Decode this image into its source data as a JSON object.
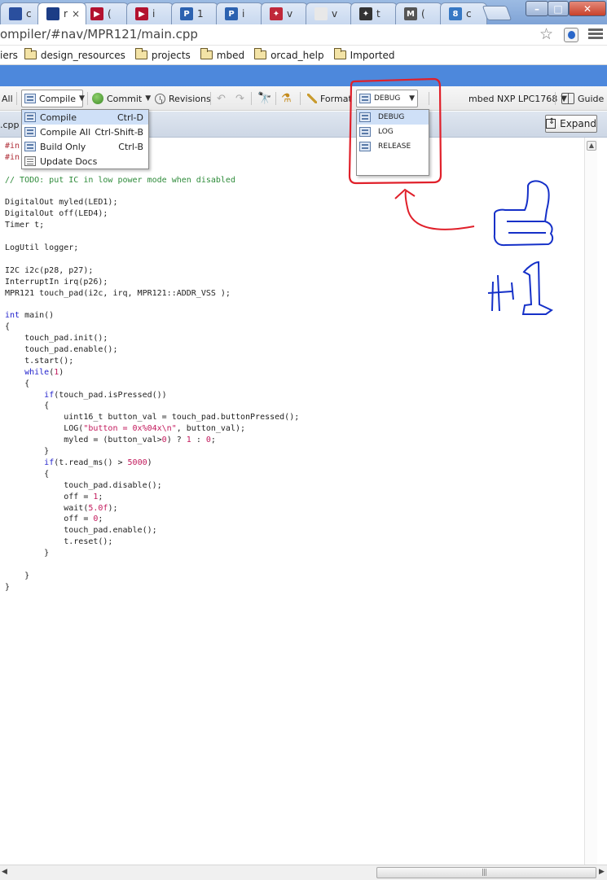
{
  "browser": {
    "tabs": [
      {
        "title": "c",
        "fav_color": "#2a4f9e",
        "fav_text": ""
      },
      {
        "title": "r",
        "fav_color": "#1c3d86",
        "fav_text": ""
      },
      {
        "title": "(",
        "fav_color": "#b3122f",
        "fav_text": "▶"
      },
      {
        "title": "i",
        "fav_color": "#b3122f",
        "fav_text": "▶"
      },
      {
        "title": "1",
        "fav_color": "#2c62b0",
        "fav_text": "P"
      },
      {
        "title": "i",
        "fav_color": "#2c62b0",
        "fav_text": "P"
      },
      {
        "title": "v",
        "fav_color": "#c0283a",
        "fav_text": "✦"
      },
      {
        "title": "v",
        "fav_color": "#e8e8e8",
        "fav_text": ""
      },
      {
        "title": "t",
        "fav_color": "#333333",
        "fav_text": "✦"
      },
      {
        "title": "(",
        "fav_color": "#555555",
        "fav_text": "M"
      },
      {
        "title": "c",
        "fav_color": "#3778c4",
        "fav_text": "8"
      }
    ],
    "active_tab_close": "×",
    "url": "ompiler/#nav/MPR121/main.cpp",
    "bookmarks": [
      {
        "label": "iers",
        "folder": false
      },
      {
        "label": "design_resources",
        "folder": true
      },
      {
        "label": "projects",
        "folder": true
      },
      {
        "label": "mbed",
        "folder": true
      },
      {
        "label": "orcad_help",
        "folder": true
      },
      {
        "label": "Imported",
        "folder": true
      }
    ]
  },
  "toolbar": {
    "all_label": "All",
    "compile_label": "Compile",
    "commit_label": "Commit",
    "revisions_label": "Revisions",
    "format_label": "Format",
    "build_profile": "DEBUG",
    "target_label": "mbed NXP LPC1768",
    "guide_label": "Guide"
  },
  "compile_menu": [
    {
      "label": "Compile",
      "shortcut": "Ctrl-D",
      "icon": "compile-icon"
    },
    {
      "label": "Compile All",
      "shortcut": "Ctrl-Shift-B",
      "icon": "compile-all-icon"
    },
    {
      "label": "Build Only",
      "shortcut": "Ctrl-B",
      "icon": "build-icon"
    },
    {
      "label": "Update Docs",
      "shortcut": "",
      "icon": "docs-icon"
    }
  ],
  "profile_menu": [
    "DEBUG",
    "LOG",
    "RELEASE"
  ],
  "editor": {
    "file_tab": ".cpp",
    "expand_label": "Expand",
    "code": [
      [
        {
          "t": "#in",
          "c": "pp"
        }
      ],
      [
        {
          "t": "#in",
          "c": "pp"
        }
      ],
      [],
      [
        {
          "t": "// TODO: put IC in low power mode when disabled",
          "c": "cm"
        }
      ],
      [],
      [
        {
          "t": "DigitalOut myled(LED1);",
          "c": ""
        }
      ],
      [
        {
          "t": "DigitalOut off(LED4);",
          "c": ""
        }
      ],
      [
        {
          "t": "Timer t;",
          "c": ""
        }
      ],
      [],
      [
        {
          "t": "LogUtil logger;",
          "c": ""
        }
      ],
      [],
      [
        {
          "t": "I2C i2c(p28, p27);",
          "c": ""
        }
      ],
      [
        {
          "t": "InterruptIn irq(p26);",
          "c": ""
        }
      ],
      [
        {
          "t": "MPR121 touch_pad(i2c, irq, MPR121::ADDR_VSS );",
          "c": ""
        }
      ],
      [],
      [
        {
          "t": "int",
          "c": "kw"
        },
        {
          "t": " main()",
          "c": ""
        }
      ],
      [
        {
          "t": "{",
          "c": ""
        }
      ],
      [
        {
          "t": "    touch_pad.init();",
          "c": ""
        }
      ],
      [
        {
          "t": "    touch_pad.enable();",
          "c": ""
        }
      ],
      [
        {
          "t": "    t.start();",
          "c": ""
        }
      ],
      [
        {
          "t": "    ",
          "c": ""
        },
        {
          "t": "while",
          "c": "kw"
        },
        {
          "t": "(",
          "c": ""
        },
        {
          "t": "1",
          "c": "nm"
        },
        {
          "t": ")",
          "c": ""
        }
      ],
      [
        {
          "t": "    {",
          "c": ""
        }
      ],
      [
        {
          "t": "        ",
          "c": ""
        },
        {
          "t": "if",
          "c": "kw"
        },
        {
          "t": "(touch_pad.isPressed())",
          "c": ""
        }
      ],
      [
        {
          "t": "        {",
          "c": ""
        }
      ],
      [
        {
          "t": "            uint16_t button_val = touch_pad.buttonPressed();",
          "c": ""
        }
      ],
      [
        {
          "t": "            LOG(",
          "c": ""
        },
        {
          "t": "\"button = 0x%04x\\n\"",
          "c": "st"
        },
        {
          "t": ", button_val);",
          "c": ""
        }
      ],
      [
        {
          "t": "            myled = (button_val>",
          "c": ""
        },
        {
          "t": "0",
          "c": "nm"
        },
        {
          "t": ") ? ",
          "c": ""
        },
        {
          "t": "1",
          "c": "nm"
        },
        {
          "t": " : ",
          "c": ""
        },
        {
          "t": "0",
          "c": "nm"
        },
        {
          "t": ";",
          "c": ""
        }
      ],
      [
        {
          "t": "        }",
          "c": ""
        }
      ],
      [
        {
          "t": "        ",
          "c": ""
        },
        {
          "t": "if",
          "c": "kw"
        },
        {
          "t": "(t.read_ms() > ",
          "c": ""
        },
        {
          "t": "5000",
          "c": "nm"
        },
        {
          "t": ")",
          "c": ""
        }
      ],
      [
        {
          "t": "        {",
          "c": ""
        }
      ],
      [
        {
          "t": "            touch_pad.disable();",
          "c": ""
        }
      ],
      [
        {
          "t": "            off = ",
          "c": ""
        },
        {
          "t": "1",
          "c": "nm"
        },
        {
          "t": ";",
          "c": ""
        }
      ],
      [
        {
          "t": "            wait(",
          "c": ""
        },
        {
          "t": "5.0f",
          "c": "nm"
        },
        {
          "t": ");",
          "c": ""
        }
      ],
      [
        {
          "t": "            off = ",
          "c": ""
        },
        {
          "t": "0",
          "c": "nm"
        },
        {
          "t": ";",
          "c": ""
        }
      ],
      [
        {
          "t": "            touch_pad.enable();",
          "c": ""
        }
      ],
      [
        {
          "t": "            t.reset();",
          "c": ""
        }
      ],
      [
        {
          "t": "        }",
          "c": ""
        }
      ],
      [],
      [
        {
          "t": "    }",
          "c": ""
        }
      ],
      [
        {
          "t": "}",
          "c": ""
        }
      ]
    ]
  },
  "annotation": {
    "box_color": "#e0202a",
    "thumb_color": "#1530c8"
  }
}
